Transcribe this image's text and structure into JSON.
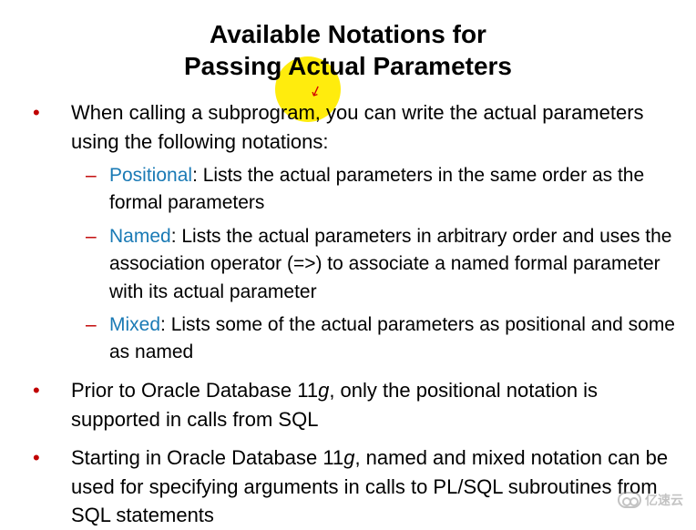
{
  "title": {
    "line1": "Available Notations for",
    "line2": "Passing Actual Parameters"
  },
  "bullets": [
    {
      "text": "When calling a subprogram, you can write the actual parameters using the following notations:",
      "sub": [
        {
          "keyword": "Positional",
          "desc": ": Lists the actual parameters in the same order as the formal parameters"
        },
        {
          "keyword": "Named",
          "desc": ": Lists the actual parameters in arbitrary order and uses the association operator (=>) to associate a named formal parameter with its actual parameter"
        },
        {
          "keyword": "Mixed",
          "desc": ": Lists some of the actual parameters as positional and some as named"
        }
      ]
    },
    {
      "pre": "Prior to Oracle Database 11",
      "italic": "g",
      "post": ", only the positional notation is supported in calls from SQL"
    },
    {
      "pre": "Starting in Oracle Database 11",
      "italic": "g",
      "post": ", named and mixed notation can be used for specifying arguments in calls to PL/SQL subroutines from SQL statements"
    }
  ],
  "watermark": "亿速云"
}
